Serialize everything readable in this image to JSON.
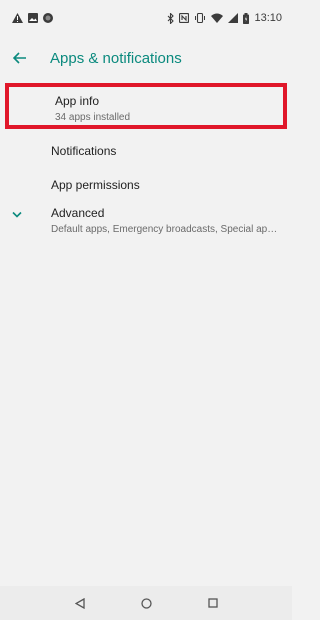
{
  "status": {
    "time": "13:10"
  },
  "appbar": {
    "title": "Apps & notifications"
  },
  "items": [
    {
      "primary": "App info",
      "secondary": "34 apps installed"
    },
    {
      "primary": "Notifications"
    },
    {
      "primary": "App permissions"
    },
    {
      "primary": "Advanced",
      "secondary": "Default apps, Emergency broadcasts, Special app access"
    }
  ],
  "colors": {
    "accent": "#0b8a7e",
    "highlight": "#e0172a"
  },
  "icons": [
    "warning-icon",
    "image-icon",
    "circle-icon",
    "bluetooth-icon",
    "nfc-icon",
    "vibrate-icon",
    "wifi-icon",
    "signal-icon",
    "battery-icon",
    "back-arrow-icon",
    "chevron-down-icon",
    "nav-back-icon",
    "nav-home-icon",
    "nav-recents-icon"
  ]
}
